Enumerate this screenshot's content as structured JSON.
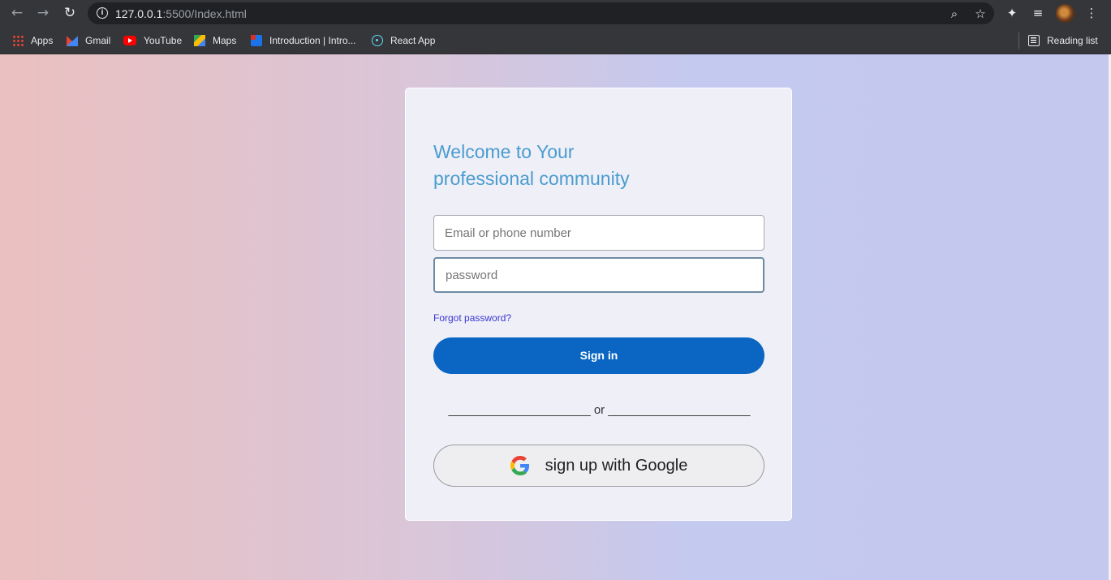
{
  "browser": {
    "url_host": "127.0.0.1",
    "url_rest": ":5500/Index.html",
    "bookmarks": [
      {
        "label": "Apps",
        "icon": "apps-grid-icon"
      },
      {
        "label": "Gmail",
        "icon": "gmail-icon"
      },
      {
        "label": "YouTube",
        "icon": "youtube-icon"
      },
      {
        "label": "Maps",
        "icon": "maps-icon"
      },
      {
        "label": "Introduction | Intro...",
        "icon": "bookmark-favicon-icon"
      },
      {
        "label": "React App",
        "icon": "react-icon"
      }
    ],
    "reading_list": "Reading list"
  },
  "login": {
    "welcome_line1": "Welcome to Your",
    "welcome_line2": "professional community",
    "email_placeholder": "Email or phone number",
    "password_placeholder": "password",
    "forgot_password": "Forgot password?",
    "signin_label": "Sign in",
    "divider_text": "_____________________ or _____________________",
    "google_label": "sign up with Google"
  },
  "colors": {
    "primary_button": "#0a66c2",
    "heading": "#4a9ccf",
    "link": "#3b37d4"
  }
}
